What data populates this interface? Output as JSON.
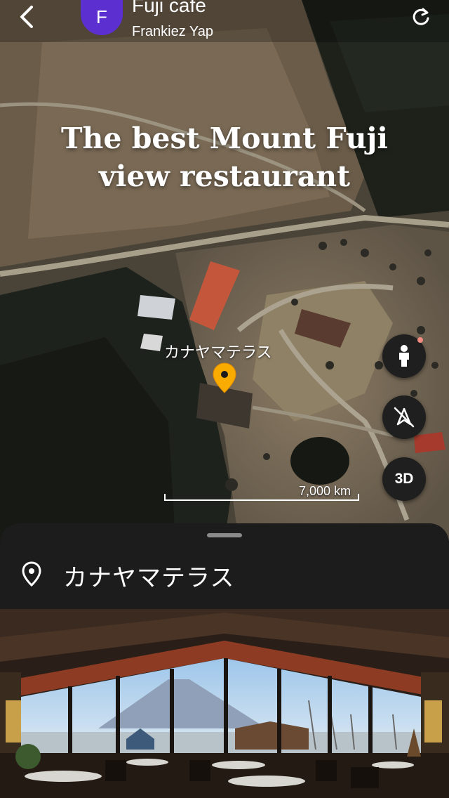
{
  "header": {
    "avatar_letter": "F",
    "title": "Fuji cafe",
    "author": "Frankiez Yap"
  },
  "story": {
    "headline_line1": "The best Mount Fuji",
    "headline_line2": "view restaurant"
  },
  "map": {
    "place_label": "カナヤマテラス",
    "scale_label": "7,000 km",
    "three_d_label": "3D"
  },
  "sheet": {
    "place_name": "カナヤマテラス"
  },
  "colors": {
    "avatar": "#5b2fd0",
    "pin": "#f9ab00",
    "sheet_bg": "#1c1c1c"
  },
  "icons": [
    "back-arrow-icon",
    "refresh-icon",
    "pegman-icon",
    "compass-off-icon",
    "location-pin-icon"
  ]
}
